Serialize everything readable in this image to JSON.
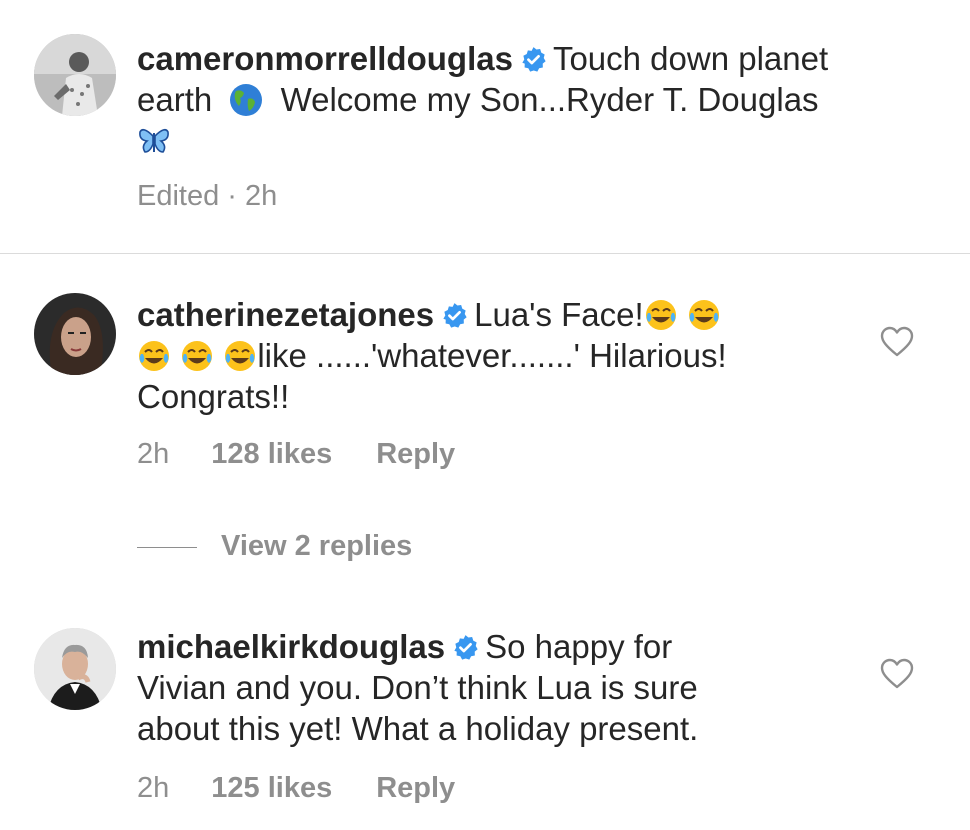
{
  "comments": [
    {
      "username": "cameronmorrelldouglas",
      "text_1": "Touch down planet",
      "text_2": "earth",
      "text_3": "Welcome my Son...Ryder T. Douglas",
      "edited": "Edited",
      "time": "2h"
    },
    {
      "username": "catherinezetajones",
      "text_1": "Lua's Face!",
      "text_2": "like ......'whatever.......' Hilarious!",
      "text_3": "Congrats!!",
      "time": "2h",
      "likes": "128 likes",
      "reply": "Reply"
    },
    {
      "username": "michaelkirkdouglas",
      "text_1": "So happy for",
      "text_2": "Vivian and you. Don’t think Lua is sure",
      "text_3": "about this yet! What a holiday present.",
      "time": "2h",
      "likes": "125 likes",
      "reply": "Reply"
    }
  ],
  "view_replies": "View 2 replies",
  "colors": {
    "text": "#262626",
    "meta": "#8e8e8e",
    "verified": "#3897f0",
    "divider": "#dbdbdb"
  },
  "icons": [
    "verified-badge-icon",
    "globe-emoji-icon",
    "butterfly-emoji-icon",
    "tears-of-joy-emoji-icon",
    "heart-icon"
  ]
}
